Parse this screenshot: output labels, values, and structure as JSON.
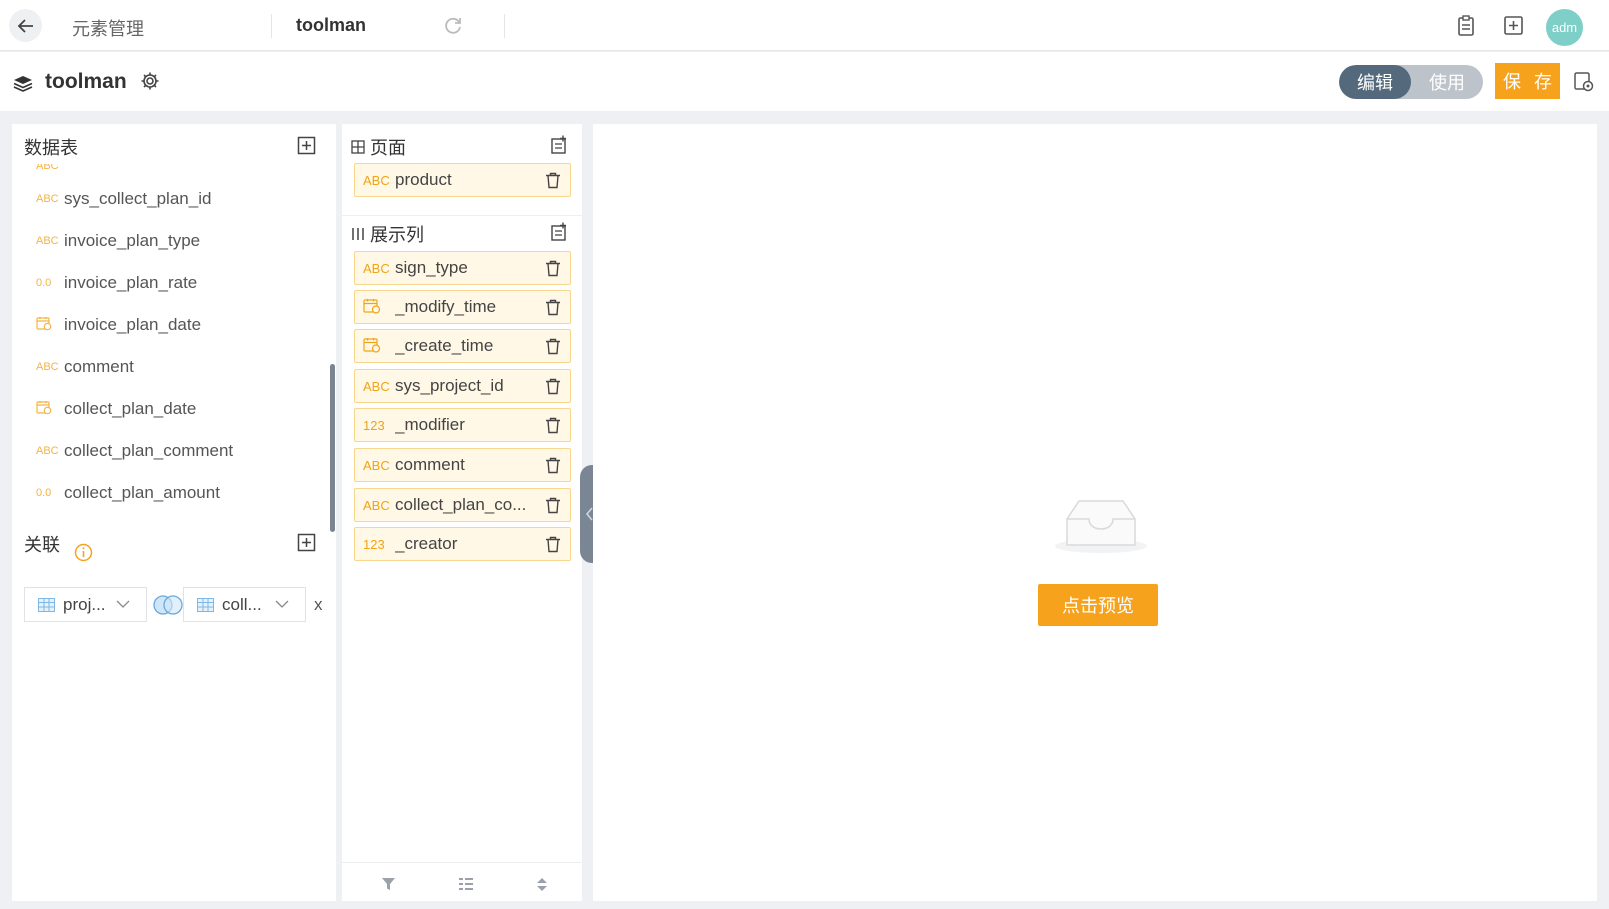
{
  "topbar": {
    "tab1": "元素管理",
    "tab2": "toolman",
    "avatar": "adm"
  },
  "title": {
    "name": "toolman",
    "mode_edit": "编辑",
    "mode_use": "使用",
    "save": "保 存"
  },
  "left": {
    "tables_title": "数据表",
    "fields": [
      {
        "type": "ABC",
        "name": "sys_collect_plan_id"
      },
      {
        "type": "ABC",
        "name": "invoice_plan_type"
      },
      {
        "type": "0.0",
        "name": "invoice_plan_rate"
      },
      {
        "type": "date",
        "name": "invoice_plan_date"
      },
      {
        "type": "ABC",
        "name": "comment"
      },
      {
        "type": "date",
        "name": "collect_plan_date"
      },
      {
        "type": "ABC",
        "name": "collect_plan_comment"
      },
      {
        "type": "0.0",
        "name": "collect_plan_amount"
      }
    ],
    "join_title": "关联",
    "join_left": "proj...",
    "join_right": "coll...",
    "join_remove": "x"
  },
  "middle": {
    "page_title": "页面",
    "page_chip": {
      "type": "ABC",
      "name": "product"
    },
    "columns_title": "展示列",
    "column_chips": [
      {
        "type": "ABC",
        "name": "sign_type"
      },
      {
        "type": "date",
        "name": "_modify_time"
      },
      {
        "type": "date",
        "name": "_create_time"
      },
      {
        "type": "ABC",
        "name": "sys_project_id"
      },
      {
        "type": "123",
        "name": "_modifier"
      },
      {
        "type": "ABC",
        "name": "comment"
      },
      {
        "type": "ABC",
        "name": "collect_plan_co..."
      },
      {
        "type": "123",
        "name": "_creator"
      }
    ]
  },
  "preview": {
    "button": "点击预览"
  },
  "colors": {
    "accent": "#f7a21c",
    "toggle_active": "#546a7c",
    "chip_bg": "#fff8e6",
    "chip_border": "#f8d68c",
    "type_tag": "#f0a417"
  }
}
